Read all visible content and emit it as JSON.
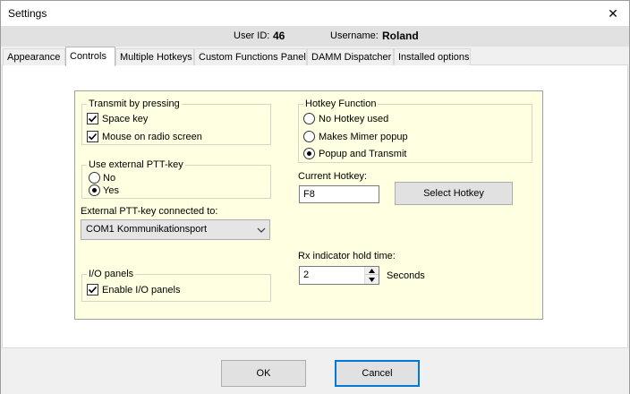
{
  "window": {
    "title": "Settings",
    "close_glyph": "✕"
  },
  "info": {
    "user_id_label": "User ID:",
    "user_id_value": "46",
    "username_label": "Username:",
    "username_value": "Roland"
  },
  "tabs": [
    {
      "label": "Appearance",
      "active": false
    },
    {
      "label": "Controls",
      "active": true
    },
    {
      "label": "Multiple Hotkeys",
      "active": false
    },
    {
      "label": "Custom Functions Panel",
      "active": false
    },
    {
      "label": "DAMM Dispatcher",
      "active": false
    },
    {
      "label": "Installed options",
      "active": false
    }
  ],
  "transmit": {
    "title": "Transmit by pressing",
    "options": [
      {
        "label": "Space key",
        "checked": true
      },
      {
        "label": "Mouse on radio screen",
        "checked": true
      }
    ]
  },
  "hotkey_function": {
    "title": "Hotkey Function",
    "options": [
      {
        "label": "No Hotkey used",
        "selected": false
      },
      {
        "label": "Makes Mimer popup",
        "selected": false
      },
      {
        "label": "Popup and Transmit",
        "selected": true
      }
    ]
  },
  "external_ptt": {
    "title": "Use external PTT-key",
    "options": [
      {
        "label": "No",
        "selected": false
      },
      {
        "label": "Yes",
        "selected": true
      }
    ]
  },
  "current_hotkey": {
    "label": "Current Hotkey:",
    "value": "F8",
    "button": "Select Hotkey"
  },
  "ptt_connected": {
    "label": "External PTT-key connected to:",
    "value": "COM1  Kommunikationsport"
  },
  "rx_indicator": {
    "label": "Rx indicator hold time:",
    "value": "2",
    "unit": "Seconds"
  },
  "io_panels": {
    "title": "I/O panels",
    "option": {
      "label": "Enable I/O panels",
      "checked": true
    }
  },
  "footer": {
    "ok": "OK",
    "cancel": "Cancel"
  },
  "colors": {
    "panel_bg": "#ffffe1",
    "focus_border": "#0078d7",
    "button_bg": "#e1e1e1"
  }
}
